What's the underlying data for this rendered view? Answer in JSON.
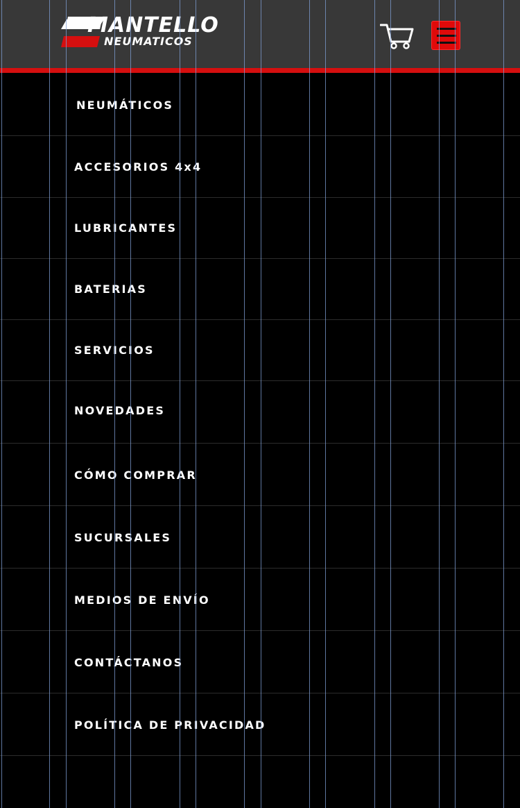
{
  "header": {
    "logo_top": "MANTELLO",
    "logo_bottom": "NEUMATICOS",
    "cart_icon": "shopping-cart-icon",
    "menu_icon": "hamburger-menu-icon"
  },
  "colors": {
    "header_bg": "#383838",
    "accent_red": "#d50f0f",
    "menu_bg": "#000000",
    "menu_text": "#ffffff"
  },
  "menu": {
    "items": [
      {
        "label": "NEUMÁTICOS"
      },
      {
        "label": "ACCESORIOS 4x4"
      },
      {
        "label": "LUBRICANTES"
      },
      {
        "label": "BATERIAS"
      },
      {
        "label": "SERVICIOS"
      },
      {
        "label": "NOVEDADES"
      },
      {
        "label": "CÓMO COMPRAR"
      },
      {
        "label": "SUCURSALES"
      },
      {
        "label": "MEDIOS DE ENVÍO"
      },
      {
        "label": "CONTÁCTANOS"
      },
      {
        "label": "POLÍTICA DE PRIVACIDAD"
      }
    ]
  }
}
